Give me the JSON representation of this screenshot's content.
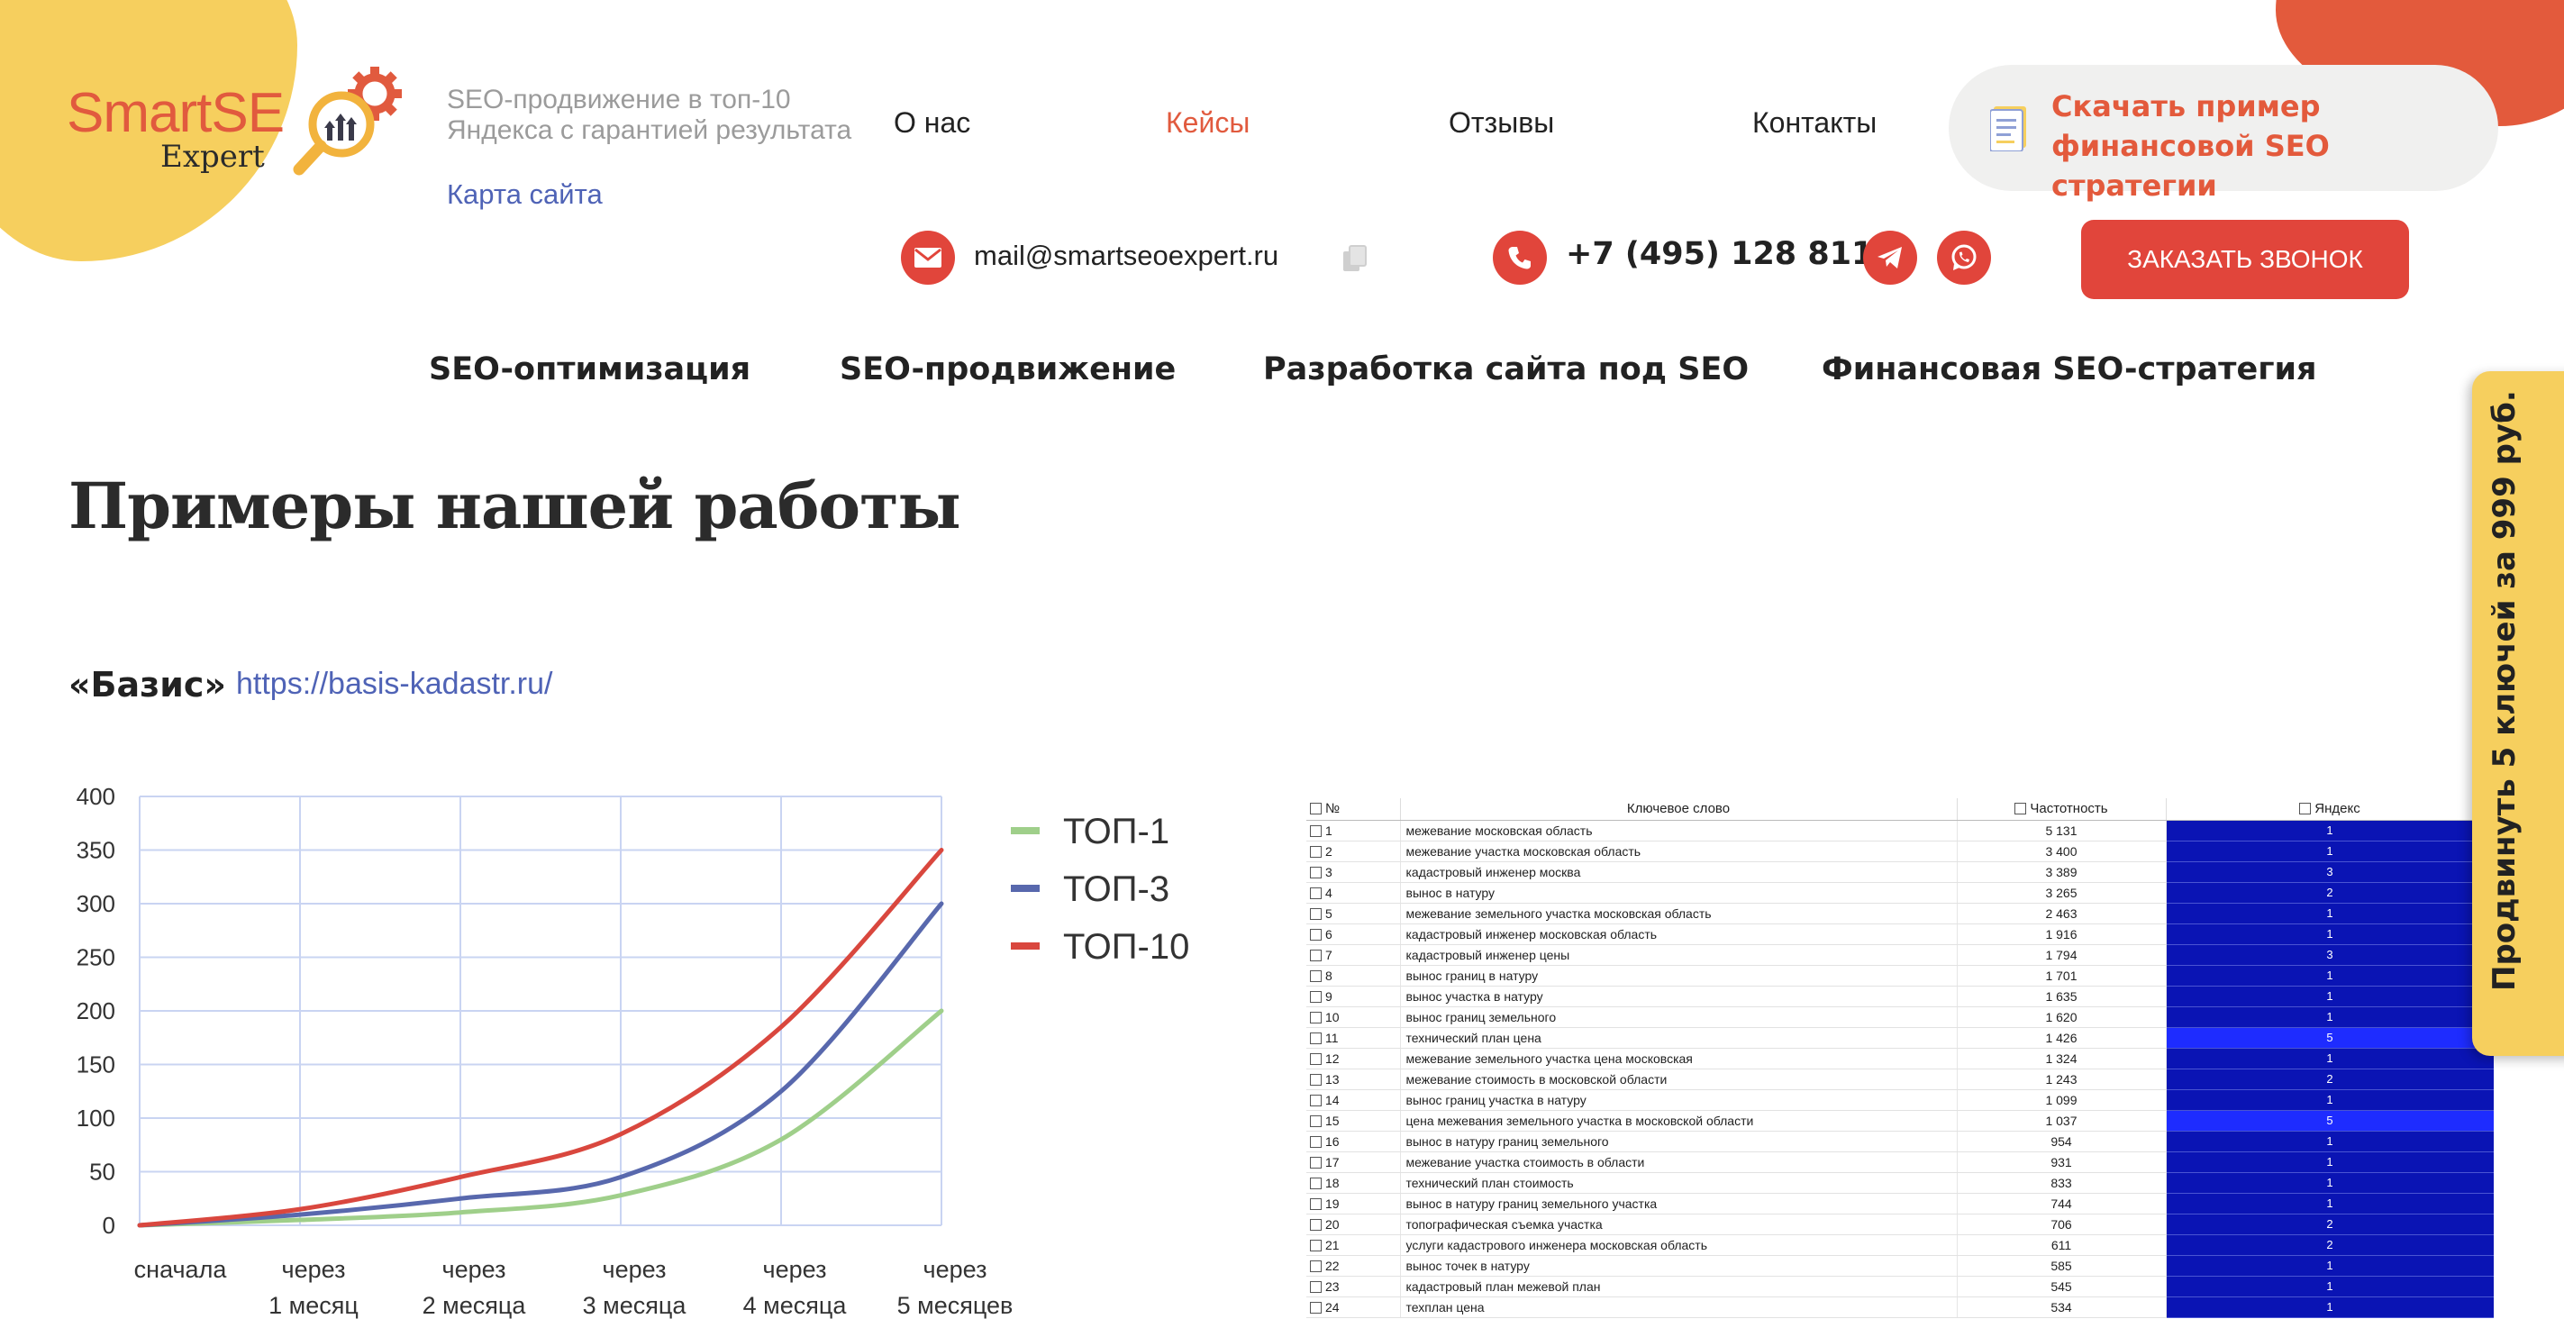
{
  "header": {
    "logo": {
      "smart": "SmartSE",
      "expert": "Expert"
    },
    "tagline": "SEO-продвижение в топ-10 Яндекса с гарантией результата",
    "sitemap_link": "Карта сайта",
    "nav": [
      {
        "label": "О нас",
        "active": false
      },
      {
        "label": "Кейсы",
        "active": true
      },
      {
        "label": "Отзывы",
        "active": false
      },
      {
        "label": "Контакты",
        "active": false
      }
    ],
    "download_cta": {
      "line1": "Скачать пример",
      "line2": "финансовой SEO стратегии",
      "icon": "document-icon"
    },
    "email": "mail@smartseoexpert.ru",
    "phone": "+7 (495) 128 8119",
    "call_button": "ЗАКАЗАТЬ ЗВОНОК",
    "icons": {
      "mail": "envelope-icon",
      "copy": "copy-icon",
      "phone": "phone-icon",
      "telegram": "telegram-icon",
      "whatsapp": "whatsapp-icon"
    }
  },
  "services_nav": [
    "SEO-оптимизация",
    "SEO-продвижение",
    "Разработка сайта под SEO",
    "Финансовая SEO-стратегия"
  ],
  "section": {
    "title": "Примеры нашей работы",
    "case_name": "«Базис»",
    "case_url": "https://basis-kadastr.ru/"
  },
  "chart_data": {
    "type": "line",
    "categories": [
      [
        "сначала"
      ],
      [
        "через",
        "1 месяц"
      ],
      [
        "через",
        "2 месяца"
      ],
      [
        "через",
        "3 месяца"
      ],
      [
        "через",
        "4 месяца"
      ],
      [
        "через",
        "5 месяцев"
      ]
    ],
    "x": [
      0,
      1,
      2,
      3,
      4,
      5
    ],
    "series": [
      {
        "name": "ТОП-1",
        "color": "#9fcf8a",
        "values": [
          0,
          5,
          12,
          28,
          80,
          200
        ]
      },
      {
        "name": "ТОП-3",
        "color": "#5868ad",
        "values": [
          0,
          10,
          25,
          45,
          125,
          300
        ]
      },
      {
        "name": "ТОП-10",
        "color": "#d9473e",
        "values": [
          0,
          15,
          45,
          85,
          185,
          350
        ]
      }
    ],
    "ylim": [
      0,
      400
    ],
    "yticks": [
      0,
      50,
      100,
      150,
      200,
      250,
      300,
      350,
      400
    ],
    "grid": true,
    "legend": "right"
  },
  "keyword_table": {
    "columns": [
      "№",
      "Ключевое слово",
      "Частотность",
      "Яндекс"
    ],
    "rows": [
      [
        "1",
        "межевание московская область",
        "5 131",
        "1"
      ],
      [
        "2",
        "межевание участка московская область",
        "3 400",
        "1"
      ],
      [
        "3",
        "кадастровый инженер москва",
        "3 389",
        "3"
      ],
      [
        "4",
        "вынос в натуру",
        "3 265",
        "2"
      ],
      [
        "5",
        "межевание земельного участка московская область",
        "2 463",
        "1"
      ],
      [
        "6",
        "кадастровый инженер московская область",
        "1 916",
        "1"
      ],
      [
        "7",
        "кадастровый инженер цены",
        "1 794",
        "3"
      ],
      [
        "8",
        "вынос границ в натуру",
        "1 701",
        "1"
      ],
      [
        "9",
        "вынос участка в натуру",
        "1 635",
        "1"
      ],
      [
        "10",
        "вынос границ земельного",
        "1 620",
        "1"
      ],
      [
        "11",
        "технический план цена",
        "1 426",
        "5"
      ],
      [
        "12",
        "межевание земельного участка цена московская",
        "1 324",
        "1"
      ],
      [
        "13",
        "межевание стоимость в московской области",
        "1 243",
        "2"
      ],
      [
        "14",
        "вынос границ участка в натуру",
        "1 099",
        "1"
      ],
      [
        "15",
        "цена межевания земельного участка в московской области",
        "1 037",
        "5"
      ],
      [
        "16",
        "вынос в натуру границ земельного",
        "954",
        "1"
      ],
      [
        "17",
        "межевание участка стоимость в области",
        "931",
        "1"
      ],
      [
        "18",
        "технический план стоимость",
        "833",
        "1"
      ],
      [
        "19",
        "вынос в натуру границ земельного участка",
        "744",
        "1"
      ],
      [
        "20",
        "топографическая съемка участка",
        "706",
        "2"
      ],
      [
        "21",
        "услуги кадастрового инженера московская область",
        "611",
        "2"
      ],
      [
        "22",
        "вынос точек в натуру",
        "585",
        "1"
      ],
      [
        "23",
        "кадастровый план межевой план",
        "545",
        "1"
      ],
      [
        "24",
        "техплан цена",
        "534",
        "1"
      ]
    ]
  },
  "promo_tab": "Продвинуть 5 ключей за 999 руб.",
  "colors": {
    "accent": "#e1453b",
    "link": "#4f63b6",
    "yellow": "#f6cf5e",
    "table_blue": "#0a14b4"
  }
}
